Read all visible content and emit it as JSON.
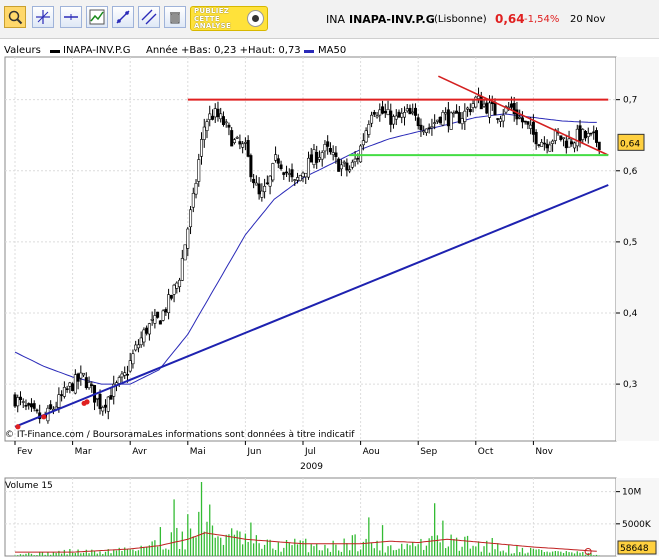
{
  "toolbar": {
    "tools": [
      "zoom-icon",
      "crosshair-icon",
      "horizontal-line-icon",
      "indicator-icon",
      "trend-line-icon",
      "parallel-line-icon",
      "trash-icon"
    ],
    "ad_text": "PUBLIEZ\nCETTE\nANALYSE"
  },
  "header": {
    "ticker": "INA",
    "name": "INAPA-INV.P.G",
    "exchange": "(Lisbonne)",
    "price": "0,64",
    "change": "-1,54%",
    "date": "20 Nov"
  },
  "legend": {
    "prefix": "Valeurs",
    "series_name": "INAPA-INV.P.G",
    "stats": "Année +Bas: 0,23 +Haut: 0,73",
    "ma_name": "MA50"
  },
  "price_badge": "0,64",
  "credit": "© IT-Finance.com / BoursoramaLes informations sont données à titre indicatif",
  "volume_panel": {
    "title": "Volume 15",
    "badge": "58648"
  },
  "colors": {
    "candle": "#000000",
    "ma50": "#2a2ab8",
    "support_line": "#1e22b0",
    "resistance_line": "#e02020",
    "down_trend": "#d42020",
    "neckline": "#44dd44",
    "volume_bar": "#33bb33",
    "volume_ma": "#c02020",
    "price_badge": "#ffd040"
  },
  "chart_data": [
    {
      "type": "candlestick",
      "year_label": "2009",
      "x_ticks": [
        "Fev",
        "Mar",
        "Avr",
        "Mai",
        "Jun",
        "Jul",
        "Aou",
        "Sep",
        "Oct",
        "Nov"
      ],
      "y_ticks": [
        "0,3",
        "0,4",
        "0,5",
        "0,6",
        "0,7"
      ],
      "y_tick_values": [
        0.3,
        0.4,
        0.5,
        0.6,
        0.7
      ],
      "ylim": [
        0.22,
        0.76
      ],
      "x_range_months": [
        0,
        10.3
      ],
      "close_keypoints": [
        [
          0,
          0.28
        ],
        [
          0.25,
          0.26
        ],
        [
          0.5,
          0.25
        ],
        [
          0.8,
          0.28
        ],
        [
          1.0,
          0.3
        ],
        [
          1.2,
          0.31
        ],
        [
          1.4,
          0.28
        ],
        [
          1.5,
          0.27
        ],
        [
          1.7,
          0.29
        ],
        [
          1.9,
          0.31
        ],
        [
          2.1,
          0.35
        ],
        [
          2.3,
          0.38
        ],
        [
          2.5,
          0.39
        ],
        [
          2.7,
          0.42
        ],
        [
          2.85,
          0.45
        ],
        [
          3.0,
          0.52
        ],
        [
          3.1,
          0.56
        ],
        [
          3.2,
          0.62
        ],
        [
          3.3,
          0.67
        ],
        [
          3.45,
          0.68
        ],
        [
          3.6,
          0.67
        ],
        [
          3.8,
          0.64
        ],
        [
          4.0,
          0.63
        ],
        [
          4.1,
          0.6
        ],
        [
          4.25,
          0.56
        ],
        [
          4.4,
          0.58
        ],
        [
          4.55,
          0.62
        ],
        [
          4.7,
          0.6
        ],
        [
          4.85,
          0.58
        ],
        [
          5.0,
          0.6
        ],
        [
          5.2,
          0.62
        ],
        [
          5.4,
          0.63
        ],
        [
          5.6,
          0.61
        ],
        [
          5.8,
          0.6
        ],
        [
          5.95,
          0.62
        ],
        [
          6.1,
          0.66
        ],
        [
          6.2,
          0.69
        ],
        [
          6.4,
          0.68
        ],
        [
          6.6,
          0.67
        ],
        [
          6.8,
          0.68
        ],
        [
          7.0,
          0.67
        ],
        [
          7.2,
          0.66
        ],
        [
          7.4,
          0.68
        ],
        [
          7.6,
          0.67
        ],
        [
          7.8,
          0.68
        ],
        [
          8.0,
          0.7
        ],
        [
          8.2,
          0.69
        ],
        [
          8.4,
          0.68
        ],
        [
          8.6,
          0.69
        ],
        [
          8.8,
          0.67
        ],
        [
          9.0,
          0.65
        ],
        [
          9.2,
          0.64
        ],
        [
          9.4,
          0.65
        ],
        [
          9.6,
          0.64
        ],
        [
          9.8,
          0.65
        ],
        [
          10.0,
          0.645
        ],
        [
          10.15,
          0.64
        ]
      ],
      "ma50_keypoints": [
        [
          0,
          0.345
        ],
        [
          0.5,
          0.325
        ],
        [
          1.0,
          0.31
        ],
        [
          1.5,
          0.3
        ],
        [
          2.0,
          0.3
        ],
        [
          2.5,
          0.32
        ],
        [
          3.0,
          0.37
        ],
        [
          3.5,
          0.44
        ],
        [
          4.0,
          0.51
        ],
        [
          4.5,
          0.56
        ],
        [
          5.0,
          0.59
        ],
        [
          5.5,
          0.61
        ],
        [
          6.0,
          0.63
        ],
        [
          6.5,
          0.645
        ],
        [
          7.0,
          0.655
        ],
        [
          7.5,
          0.665
        ],
        [
          8.0,
          0.675
        ],
        [
          8.5,
          0.68
        ],
        [
          9.0,
          0.675
        ],
        [
          9.5,
          0.67
        ],
        [
          10.0,
          0.668
        ]
      ],
      "annotations": {
        "support_line": [
          [
            0,
            0.24
          ],
          [
            10.3,
            0.58
          ]
        ],
        "resistance_line": [
          [
            3.0,
            0.7
          ],
          [
            10.3,
            0.7
          ]
        ],
        "down_trend": [
          [
            7.35,
            0.733
          ],
          [
            10.3,
            0.622
          ]
        ],
        "neckline": [
          [
            5.8,
            0.622
          ],
          [
            10.3,
            0.622
          ]
        ],
        "touch_points": [
          [
            0.05,
            0.24
          ],
          [
            0.5,
            0.254
          ],
          [
            1.2,
            0.273
          ],
          [
            1.25,
            0.275
          ]
        ]
      }
    },
    {
      "type": "bar",
      "title": "Volume 15",
      "y_ticks": [
        "10M",
        "5000K"
      ],
      "y_tick_values": [
        10000000,
        5000000
      ],
      "ylim": [
        0,
        11500000
      ],
      "last_value": 58648,
      "volume_keypoints": [
        [
          0,
          300000
        ],
        [
          0.5,
          400000
        ],
        [
          1.0,
          700000
        ],
        [
          1.5,
          600000
        ],
        [
          2.0,
          1200000
        ],
        [
          2.5,
          1800000
        ],
        [
          3.0,
          3500000
        ],
        [
          3.3,
          5500000
        ],
        [
          3.5,
          3500000
        ],
        [
          4.0,
          2200000
        ],
        [
          4.5,
          1500000
        ],
        [
          5.0,
          1800000
        ],
        [
          5.5,
          1400000
        ],
        [
          6.0,
          2500000
        ],
        [
          6.5,
          1500000
        ],
        [
          7.0,
          1800000
        ],
        [
          7.5,
          2200000
        ],
        [
          8.0,
          1800000
        ],
        [
          8.5,
          1200000
        ],
        [
          9.0,
          900000
        ],
        [
          9.5,
          600000
        ],
        [
          10.0,
          300000
        ],
        [
          10.15,
          58648
        ]
      ],
      "volume_spikes": [
        [
          3.0,
          6500000
        ],
        [
          3.25,
          11500000
        ],
        [
          3.4,
          8000000
        ],
        [
          2.75,
          8800000
        ],
        [
          2.5,
          4500000
        ],
        [
          4.1,
          5200000
        ],
        [
          6.15,
          6000000
        ],
        [
          6.4,
          4800000
        ],
        [
          7.3,
          8200000
        ],
        [
          7.45,
          5500000
        ],
        [
          8.3,
          2800000
        ],
        [
          3.9,
          3800000
        ]
      ],
      "volume_ma_keypoints": [
        [
          0,
          600000
        ],
        [
          1.0,
          600000
        ],
        [
          2.0,
          1100000
        ],
        [
          2.5,
          1600000
        ],
        [
          3.0,
          2600000
        ],
        [
          3.3,
          3600000
        ],
        [
          3.6,
          3200000
        ],
        [
          4.0,
          2600000
        ],
        [
          5.0,
          1900000
        ],
        [
          6.0,
          1900000
        ],
        [
          6.5,
          2300000
        ],
        [
          7.0,
          2100000
        ],
        [
          7.5,
          2600000
        ],
        [
          8.0,
          2200000
        ],
        [
          9.0,
          1400000
        ],
        [
          10.0,
          800000
        ],
        [
          10.15,
          700000
        ]
      ]
    }
  ]
}
